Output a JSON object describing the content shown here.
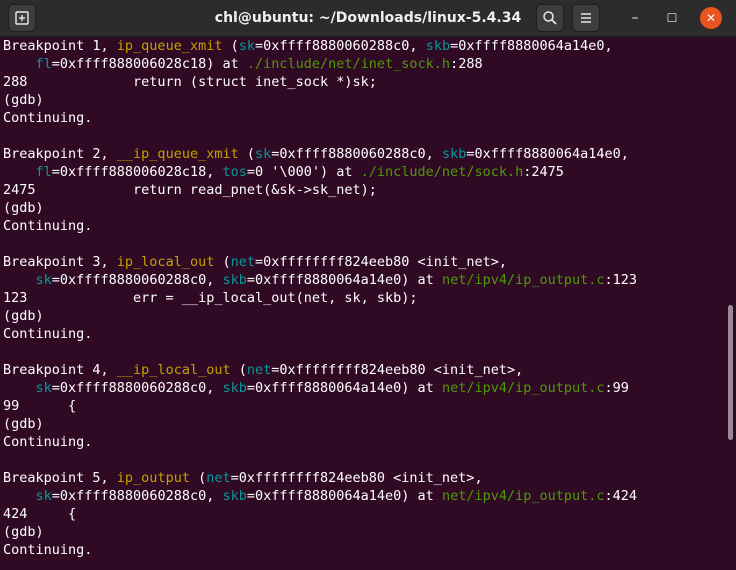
{
  "window": {
    "title": "chl@ubuntu: ~/Downloads/linux-5.4.34",
    "new_tab_icon": "new-tab-icon",
    "search_icon": "search-icon",
    "menu_icon": "hamburger-menu-icon",
    "minimize_symbol": "–",
    "maximize_symbol": "☐",
    "close_symbol": "✕"
  },
  "colors": {
    "background": "#300a24",
    "function": "#c4a000",
    "argument": "#06989a",
    "path": "#4e9a06",
    "text": "#ffffff",
    "close_button": "#e9541f"
  },
  "terminal": {
    "lines": [
      [
        {
          "t": "Breakpoint 1, "
        },
        {
          "t": "ip_queue_xmit",
          "c": "fn"
        },
        {
          "t": " ("
        },
        {
          "t": "sk",
          "c": "arg"
        },
        {
          "t": "=0xffff8880060288c0, "
        },
        {
          "t": "skb",
          "c": "arg"
        },
        {
          "t": "=0xffff8880064a14e0,"
        }
      ],
      [
        {
          "t": "    "
        },
        {
          "t": "fl",
          "c": "arg"
        },
        {
          "t": "=0xffff888006028c18) at "
        },
        {
          "t": "./include/net/inet_sock.h",
          "c": "path"
        },
        {
          "t": ":288"
        }
      ],
      [
        {
          "t": "288             return (struct inet_sock *)sk;"
        }
      ],
      [
        {
          "t": "(gdb)"
        }
      ],
      [
        {
          "t": "Continuing."
        }
      ],
      [
        {
          "t": ""
        }
      ],
      [
        {
          "t": "Breakpoint 2, "
        },
        {
          "t": "__ip_queue_xmit",
          "c": "fn"
        },
        {
          "t": " ("
        },
        {
          "t": "sk",
          "c": "arg"
        },
        {
          "t": "=0xffff8880060288c0, "
        },
        {
          "t": "skb",
          "c": "arg"
        },
        {
          "t": "=0xffff8880064a14e0,"
        }
      ],
      [
        {
          "t": "    "
        },
        {
          "t": "fl",
          "c": "arg"
        },
        {
          "t": "=0xffff888006028c18, "
        },
        {
          "t": "tos",
          "c": "arg"
        },
        {
          "t": "=0 '\\000') at "
        },
        {
          "t": "./include/net/sock.h",
          "c": "path"
        },
        {
          "t": ":2475"
        }
      ],
      [
        {
          "t": "2475            return read_pnet(&sk->sk_net);"
        }
      ],
      [
        {
          "t": "(gdb)"
        }
      ],
      [
        {
          "t": "Continuing."
        }
      ],
      [
        {
          "t": ""
        }
      ],
      [
        {
          "t": "Breakpoint 3, "
        },
        {
          "t": "ip_local_out",
          "c": "fn"
        },
        {
          "t": " ("
        },
        {
          "t": "net",
          "c": "arg"
        },
        {
          "t": "=0xffffffff824eeb80 <init_net>,"
        }
      ],
      [
        {
          "t": "    "
        },
        {
          "t": "sk",
          "c": "arg"
        },
        {
          "t": "=0xffff8880060288c0, "
        },
        {
          "t": "skb",
          "c": "arg"
        },
        {
          "t": "=0xffff8880064a14e0) at "
        },
        {
          "t": "net/ipv4/ip_output.c",
          "c": "path"
        },
        {
          "t": ":123"
        }
      ],
      [
        {
          "t": "123             err = __ip_local_out(net, sk, skb);"
        }
      ],
      [
        {
          "t": "(gdb)"
        }
      ],
      [
        {
          "t": "Continuing."
        }
      ],
      [
        {
          "t": ""
        }
      ],
      [
        {
          "t": "Breakpoint 4, "
        },
        {
          "t": "__ip_local_out",
          "c": "fn"
        },
        {
          "t": " ("
        },
        {
          "t": "net",
          "c": "arg"
        },
        {
          "t": "=0xffffffff824eeb80 <init_net>,"
        }
      ],
      [
        {
          "t": "    "
        },
        {
          "t": "sk",
          "c": "arg"
        },
        {
          "t": "=0xffff8880060288c0, "
        },
        {
          "t": "skb",
          "c": "arg"
        },
        {
          "t": "=0xffff8880064a14e0) at "
        },
        {
          "t": "net/ipv4/ip_output.c",
          "c": "path"
        },
        {
          "t": ":99"
        }
      ],
      [
        {
          "t": "99      {"
        }
      ],
      [
        {
          "t": "(gdb)"
        }
      ],
      [
        {
          "t": "Continuing."
        }
      ],
      [
        {
          "t": ""
        }
      ],
      [
        {
          "t": "Breakpoint 5, "
        },
        {
          "t": "ip_output",
          "c": "fn"
        },
        {
          "t": " ("
        },
        {
          "t": "net",
          "c": "arg"
        },
        {
          "t": "=0xffffffff824eeb80 <init_net>,"
        }
      ],
      [
        {
          "t": "    "
        },
        {
          "t": "sk",
          "c": "arg"
        },
        {
          "t": "=0xffff8880060288c0, "
        },
        {
          "t": "skb",
          "c": "arg"
        },
        {
          "t": "=0xffff8880064a14e0) at "
        },
        {
          "t": "net/ipv4/ip_output.c",
          "c": "path"
        },
        {
          "t": ":424"
        }
      ],
      [
        {
          "t": "424     {"
        }
      ],
      [
        {
          "t": "(gdb)"
        }
      ],
      [
        {
          "t": "Continuing."
        }
      ]
    ]
  }
}
